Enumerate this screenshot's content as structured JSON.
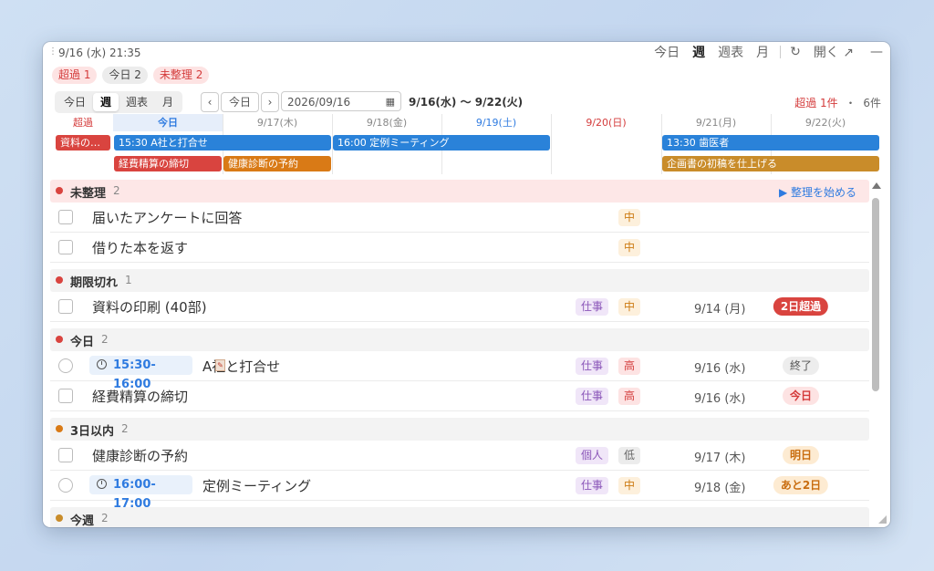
{
  "titlebar": {
    "datetime": "9/16 (水) 21:35",
    "views": [
      "今日",
      "週",
      "週表",
      "月"
    ],
    "active_view": "週",
    "refresh_icon": "↻",
    "open_label": "開く",
    "open_icon": "↗",
    "minimize_icon": "—"
  },
  "chips": [
    {
      "label": "超過 1",
      "style": "red"
    },
    {
      "label": "今日 2",
      "style": "gray"
    },
    {
      "label": "未整理 2",
      "style": "red"
    }
  ],
  "toolbar": {
    "seg": [
      "今日",
      "週",
      "週表",
      "月"
    ],
    "active_seg": "週",
    "prev": "‹",
    "today": "今日",
    "next": "›",
    "date_value": "2026/09/16",
    "range": "9/16(水) 〜 9/22(火)",
    "summary_overdue": "超過 1件",
    "summary_sep": "・",
    "summary_count": "6件"
  },
  "calendar": {
    "columns": [
      {
        "label": "超過",
        "style": "over"
      },
      {
        "label": "今日",
        "style": "today"
      },
      {
        "label": "9/17(木)",
        "style": "normal"
      },
      {
        "label": "9/18(金)",
        "style": "normal"
      },
      {
        "label": "9/19(土)",
        "style": "sat"
      },
      {
        "label": "9/20(日)",
        "style": "sun"
      },
      {
        "label": "9/21(月)",
        "style": "normal"
      },
      {
        "label": "9/22(火)",
        "style": "normal"
      }
    ],
    "events": [
      {
        "label": "資料の…",
        "color": "red",
        "col": 0,
        "span": 1,
        "row": 0
      },
      {
        "label": "15:30 A社と打合せ",
        "color": "blue",
        "col": 1,
        "span": 2,
        "row": 0
      },
      {
        "label": "16:00 定例ミーティング",
        "color": "blue",
        "col": 3,
        "span": 2,
        "row": 0
      },
      {
        "label": "13:30 歯医者",
        "color": "blue",
        "col": 6,
        "span": 2,
        "row": 0
      },
      {
        "label": "経費精算の締切",
        "color": "red",
        "col": 1,
        "span": 1,
        "row": 1
      },
      {
        "label": "健康診断の予約",
        "color": "orange",
        "col": 2,
        "span": 1,
        "row": 1
      },
      {
        "label": "企画書の初稿を仕上げる",
        "color": "gold",
        "col": 6,
        "span": 2,
        "row": 1
      }
    ]
  },
  "groups": [
    {
      "title": "未整理",
      "count": "2",
      "dot": "#d9443f",
      "alert": true,
      "action": "▶ 整理を始める",
      "rows": [
        {
          "kind": "check",
          "title": "届いたアンケートに回答",
          "priority": "中",
          "pri_style": "mid"
        },
        {
          "kind": "check",
          "title": "借りた本を返す",
          "priority": "中",
          "pri_style": "mid"
        }
      ]
    },
    {
      "title": "期限切れ",
      "count": "1",
      "dot": "#d9443f",
      "rows": [
        {
          "kind": "check",
          "title": "資料の印刷 (40部)",
          "tag": "仕事",
          "priority": "中",
          "pri_style": "mid",
          "due": "9/14 (月)",
          "badge": "2日超過",
          "badge_style": "over"
        }
      ]
    },
    {
      "title": "今日",
      "count": "2",
      "dot": "#d9443f",
      "rows": [
        {
          "kind": "radio",
          "time": "15:30-16:00",
          "title": "A社と打合せ",
          "memo": true,
          "tag": "仕事",
          "priority": "高",
          "pri_style": "high",
          "due": "9/16 (水)",
          "badge": "終了",
          "badge_style": "done"
        },
        {
          "kind": "check",
          "title": "経費精算の締切",
          "tag": "仕事",
          "priority": "高",
          "pri_style": "high",
          "due": "9/16 (水)",
          "badge": "今日",
          "badge_style": "today"
        }
      ]
    },
    {
      "title": "3日以内",
      "count": "2",
      "dot": "#d97a16",
      "rows": [
        {
          "kind": "check",
          "title": "健康診断の予約",
          "tag": "個人",
          "priority": "低",
          "pri_style": "low",
          "due": "9/17 (木)",
          "badge": "明日",
          "badge_style": "tmr"
        },
        {
          "kind": "radio",
          "time": "16:00-17:00",
          "title": "定例ミーティング",
          "tag": "仕事",
          "priority": "中",
          "pri_style": "mid",
          "due": "9/18 (金)",
          "badge": "あと2日",
          "badge_style": "tmr"
        }
      ]
    },
    {
      "title": "今週",
      "count": "2",
      "dot": "#c98c2a",
      "rows": []
    }
  ]
}
